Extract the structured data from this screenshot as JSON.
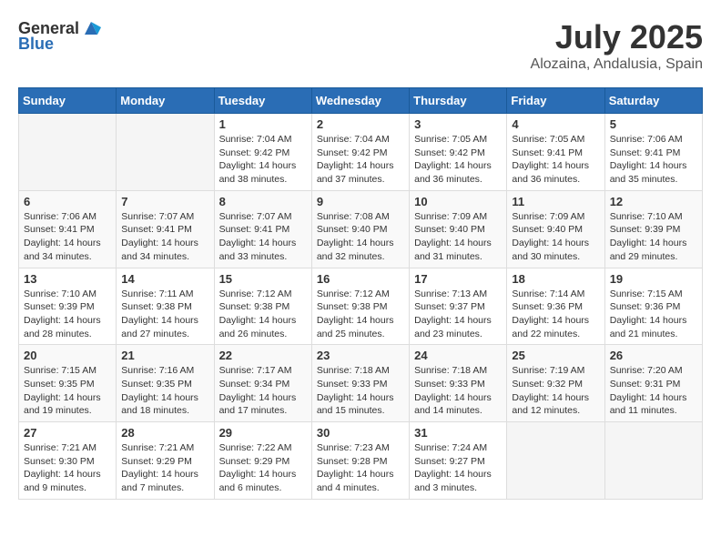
{
  "header": {
    "logo_general": "General",
    "logo_blue": "Blue",
    "month": "July 2025",
    "location": "Alozaina, Andalusia, Spain"
  },
  "days_of_week": [
    "Sunday",
    "Monday",
    "Tuesday",
    "Wednesday",
    "Thursday",
    "Friday",
    "Saturday"
  ],
  "weeks": [
    [
      {
        "day": "",
        "info": ""
      },
      {
        "day": "",
        "info": ""
      },
      {
        "day": "1",
        "info": "Sunrise: 7:04 AM\nSunset: 9:42 PM\nDaylight: 14 hours and 38 minutes."
      },
      {
        "day": "2",
        "info": "Sunrise: 7:04 AM\nSunset: 9:42 PM\nDaylight: 14 hours and 37 minutes."
      },
      {
        "day": "3",
        "info": "Sunrise: 7:05 AM\nSunset: 9:42 PM\nDaylight: 14 hours and 36 minutes."
      },
      {
        "day": "4",
        "info": "Sunrise: 7:05 AM\nSunset: 9:41 PM\nDaylight: 14 hours and 36 minutes."
      },
      {
        "day": "5",
        "info": "Sunrise: 7:06 AM\nSunset: 9:41 PM\nDaylight: 14 hours and 35 minutes."
      }
    ],
    [
      {
        "day": "6",
        "info": "Sunrise: 7:06 AM\nSunset: 9:41 PM\nDaylight: 14 hours and 34 minutes."
      },
      {
        "day": "7",
        "info": "Sunrise: 7:07 AM\nSunset: 9:41 PM\nDaylight: 14 hours and 34 minutes."
      },
      {
        "day": "8",
        "info": "Sunrise: 7:07 AM\nSunset: 9:41 PM\nDaylight: 14 hours and 33 minutes."
      },
      {
        "day": "9",
        "info": "Sunrise: 7:08 AM\nSunset: 9:40 PM\nDaylight: 14 hours and 32 minutes."
      },
      {
        "day": "10",
        "info": "Sunrise: 7:09 AM\nSunset: 9:40 PM\nDaylight: 14 hours and 31 minutes."
      },
      {
        "day": "11",
        "info": "Sunrise: 7:09 AM\nSunset: 9:40 PM\nDaylight: 14 hours and 30 minutes."
      },
      {
        "day": "12",
        "info": "Sunrise: 7:10 AM\nSunset: 9:39 PM\nDaylight: 14 hours and 29 minutes."
      }
    ],
    [
      {
        "day": "13",
        "info": "Sunrise: 7:10 AM\nSunset: 9:39 PM\nDaylight: 14 hours and 28 minutes."
      },
      {
        "day": "14",
        "info": "Sunrise: 7:11 AM\nSunset: 9:38 PM\nDaylight: 14 hours and 27 minutes."
      },
      {
        "day": "15",
        "info": "Sunrise: 7:12 AM\nSunset: 9:38 PM\nDaylight: 14 hours and 26 minutes."
      },
      {
        "day": "16",
        "info": "Sunrise: 7:12 AM\nSunset: 9:38 PM\nDaylight: 14 hours and 25 minutes."
      },
      {
        "day": "17",
        "info": "Sunrise: 7:13 AM\nSunset: 9:37 PM\nDaylight: 14 hours and 23 minutes."
      },
      {
        "day": "18",
        "info": "Sunrise: 7:14 AM\nSunset: 9:36 PM\nDaylight: 14 hours and 22 minutes."
      },
      {
        "day": "19",
        "info": "Sunrise: 7:15 AM\nSunset: 9:36 PM\nDaylight: 14 hours and 21 minutes."
      }
    ],
    [
      {
        "day": "20",
        "info": "Sunrise: 7:15 AM\nSunset: 9:35 PM\nDaylight: 14 hours and 19 minutes."
      },
      {
        "day": "21",
        "info": "Sunrise: 7:16 AM\nSunset: 9:35 PM\nDaylight: 14 hours and 18 minutes."
      },
      {
        "day": "22",
        "info": "Sunrise: 7:17 AM\nSunset: 9:34 PM\nDaylight: 14 hours and 17 minutes."
      },
      {
        "day": "23",
        "info": "Sunrise: 7:18 AM\nSunset: 9:33 PM\nDaylight: 14 hours and 15 minutes."
      },
      {
        "day": "24",
        "info": "Sunrise: 7:18 AM\nSunset: 9:33 PM\nDaylight: 14 hours and 14 minutes."
      },
      {
        "day": "25",
        "info": "Sunrise: 7:19 AM\nSunset: 9:32 PM\nDaylight: 14 hours and 12 minutes."
      },
      {
        "day": "26",
        "info": "Sunrise: 7:20 AM\nSunset: 9:31 PM\nDaylight: 14 hours and 11 minutes."
      }
    ],
    [
      {
        "day": "27",
        "info": "Sunrise: 7:21 AM\nSunset: 9:30 PM\nDaylight: 14 hours and 9 minutes."
      },
      {
        "day": "28",
        "info": "Sunrise: 7:21 AM\nSunset: 9:29 PM\nDaylight: 14 hours and 7 minutes."
      },
      {
        "day": "29",
        "info": "Sunrise: 7:22 AM\nSunset: 9:29 PM\nDaylight: 14 hours and 6 minutes."
      },
      {
        "day": "30",
        "info": "Sunrise: 7:23 AM\nSunset: 9:28 PM\nDaylight: 14 hours and 4 minutes."
      },
      {
        "day": "31",
        "info": "Sunrise: 7:24 AM\nSunset: 9:27 PM\nDaylight: 14 hours and 3 minutes."
      },
      {
        "day": "",
        "info": ""
      },
      {
        "day": "",
        "info": ""
      }
    ]
  ]
}
